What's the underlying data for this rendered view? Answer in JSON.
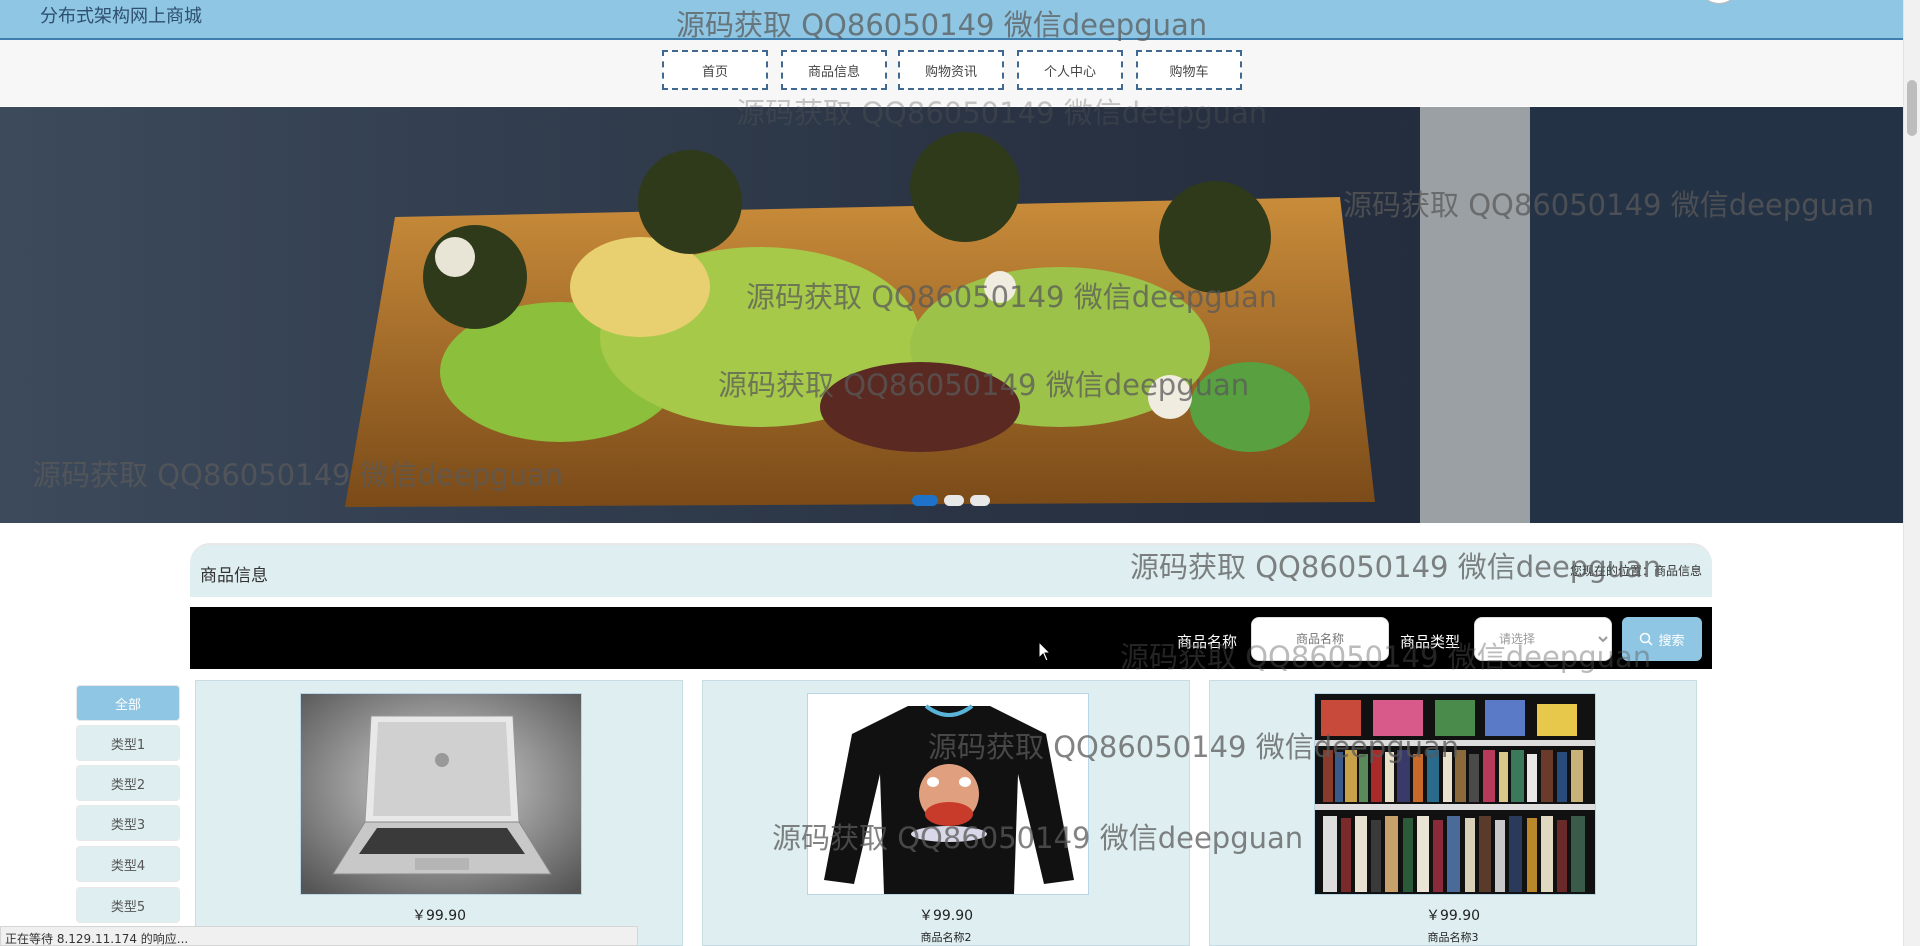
{
  "app": {
    "title": "分布式架构网上商城"
  },
  "nav": {
    "items": [
      {
        "label": "首页"
      },
      {
        "label": "商品信息"
      },
      {
        "label": "购物资讯"
      },
      {
        "label": "个人中心"
      },
      {
        "label": "购物车"
      }
    ]
  },
  "banner": {
    "slide_count": 3,
    "active_slide": 1
  },
  "section": {
    "title": "商品信息",
    "breadcrumb": "您现在的位置：商品信息"
  },
  "search": {
    "name_label": "商品名称",
    "name_placeholder": "商品名称",
    "type_label": "商品类型",
    "type_value": "请选择",
    "button_label": "搜索"
  },
  "categories": [
    {
      "label": "全部"
    },
    {
      "label": "类型1"
    },
    {
      "label": "类型2"
    },
    {
      "label": "类型3"
    },
    {
      "label": "类型4"
    },
    {
      "label": "类型5"
    }
  ],
  "products": [
    {
      "price": "￥99.90",
      "name": "",
      "image": "laptop"
    },
    {
      "price": "￥99.90",
      "name": "商品名称2",
      "image": "black-sweatshirt"
    },
    {
      "price": "￥99.90",
      "name": "商品名称3",
      "image": "bookshelf"
    }
  ],
  "status": {
    "text": "正在等待 8.129.11.174 的响应..."
  },
  "watermark": {
    "text": "源码获取 QQ86050149 微信deepguan"
  },
  "colors": {
    "accent": "#8ec6e3",
    "nav_border": "#3f6990",
    "panel": "#dfeff1",
    "active_dot": "#1e73c8"
  }
}
